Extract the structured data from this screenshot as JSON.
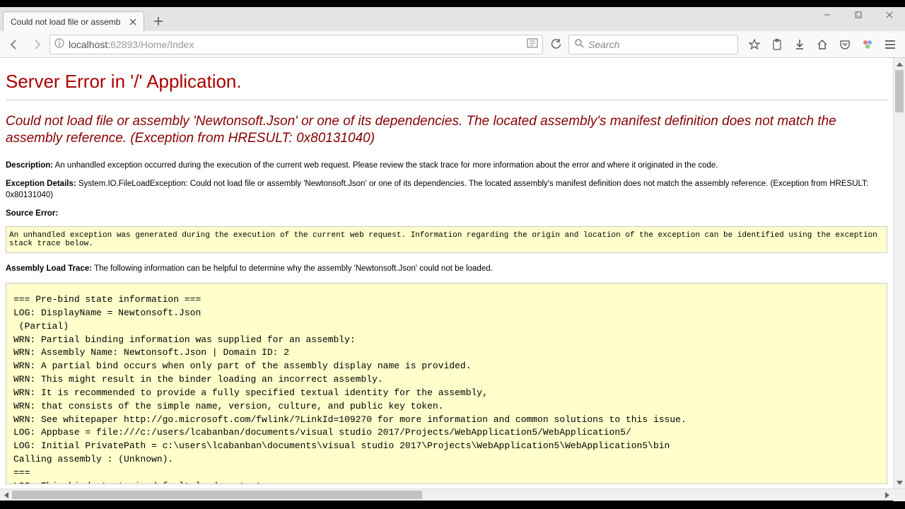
{
  "browser": {
    "tab_title": "Could not load file or assembly",
    "url_host": "localhost:",
    "url_port_path": "62893/Home/Index",
    "search_placeholder": "Search"
  },
  "error": {
    "title": "Server Error in '/' Application.",
    "heading": "Could not load file or assembly 'Newtonsoft.Json' or one of its dependencies. The located assembly's manifest definition does not match the assembly reference. (Exception from HRESULT: 0x80131040)",
    "description_label": "Description:",
    "description_text": "An unhandled exception occurred during the execution of the current web request. Please review the stack trace for more information about the error and where it originated in the code.",
    "exception_label": "Exception Details:",
    "exception_text": "System.IO.FileLoadException: Could not load file or assembly 'Newtonsoft.Json' or one of its dependencies. The located assembly's manifest definition does not match the assembly reference. (Exception from HRESULT: 0x80131040)",
    "source_label": "Source Error:",
    "source_text": "An unhandled exception was generated during the execution of the current web request. Information regarding the origin and location of the exception can be identified using the exception stack trace below.",
    "trace_label": "Assembly Load Trace:",
    "trace_intro": "The following information can be helpful to determine why the assembly 'Newtonsoft.Json' could not be loaded.",
    "trace_body": "=== Pre-bind state information ===\nLOG: DisplayName = Newtonsoft.Json\n (Partial)\nWRN: Partial binding information was supplied for an assembly:\nWRN: Assembly Name: Newtonsoft.Json | Domain ID: 2\nWRN: A partial bind occurs when only part of the assembly display name is provided.\nWRN: This might result in the binder loading an incorrect assembly.\nWRN: It is recommended to provide a fully specified textual identity for the assembly,\nWRN: that consists of the simple name, version, culture, and public key token.\nWRN: See whitepaper http://go.microsoft.com/fwlink/?LinkId=109270 for more information and common solutions to this issue.\nLOG: Appbase = file:///c:/users/lcabanban/documents/visual studio 2017/Projects/WebApplication5/WebApplication5/\nLOG: Initial PrivatePath = c:\\users\\lcabanban\\documents\\visual studio 2017\\Projects\\WebApplication5\\WebApplication5\\bin\nCalling assembly : (Unknown).\n===\nLOG: This bind starts in default load context."
  }
}
